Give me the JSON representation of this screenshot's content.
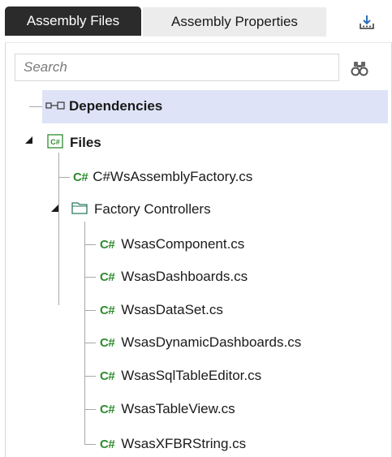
{
  "tabs": [
    {
      "label": "Assembly Files",
      "active": true
    },
    {
      "label": "Assembly Properties",
      "active": false
    }
  ],
  "toolbar": {
    "export_icon": "download-tray-icon"
  },
  "search": {
    "placeholder": "Search",
    "value": "",
    "filter_icon": "binoculars-icon"
  },
  "colors": {
    "active_tab_bg": "#2b2b2b",
    "inactive_tab_bg": "#ececec",
    "selected_row_bg": "#dfe3f7",
    "csharp_icon": "#2e8b2e"
  },
  "tree": {
    "dependencies": {
      "label": "Dependencies",
      "icon": "dependency-link-icon",
      "selected": true
    },
    "files": {
      "label": "Files",
      "icon": "csharp-project-icon",
      "expanded": true
    },
    "root_file": {
      "label": "C#WsAssemblyFactory.cs",
      "icon": "csharp-file-icon",
      "prefix": "C#"
    },
    "folder": {
      "label": "Factory Controllers",
      "icon": "folder-icon",
      "expanded": true
    },
    "folder_files": [
      {
        "label": "WsasComponent.cs",
        "prefix": "C#"
      },
      {
        "label": "WsasDashboards.cs",
        "prefix": "C#"
      },
      {
        "label": "WsasDataSet.cs",
        "prefix": "C#"
      },
      {
        "label": "WsasDynamicDashboards.cs",
        "prefix": "C#"
      },
      {
        "label": "WsasSqlTableEditor.cs",
        "prefix": "C#"
      },
      {
        "label": "WsasTableView.cs",
        "prefix": "C#"
      },
      {
        "label": "WsasXFBRString.cs",
        "prefix": "C#"
      }
    ]
  }
}
